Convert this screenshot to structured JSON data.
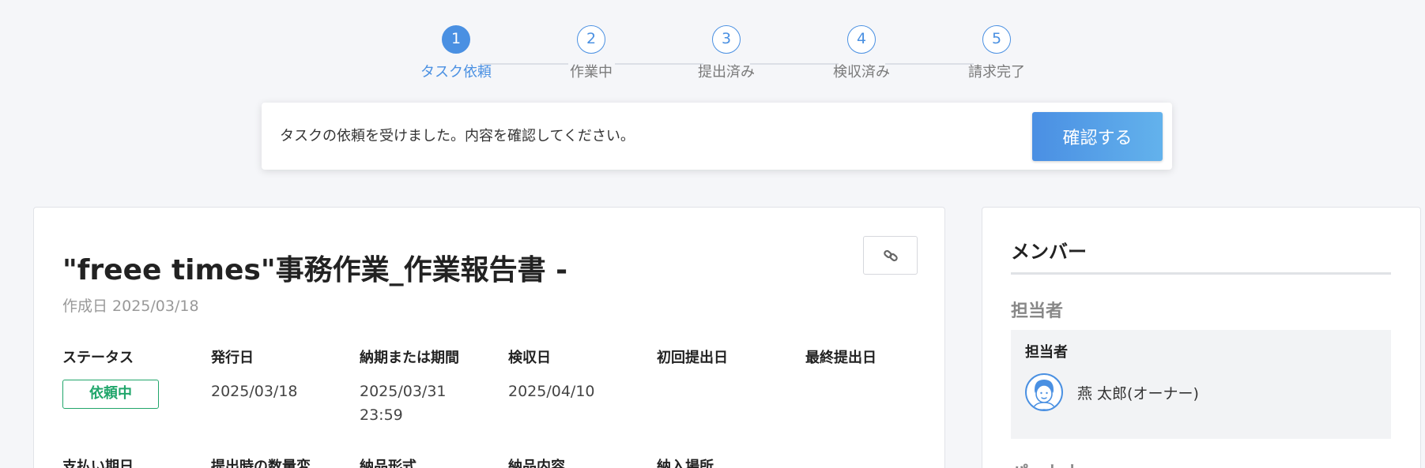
{
  "stepper": {
    "steps": [
      {
        "number": "1",
        "label": "タスク依頼",
        "active": true
      },
      {
        "number": "2",
        "label": "作業中",
        "active": false
      },
      {
        "number": "3",
        "label": "提出済み",
        "active": false
      },
      {
        "number": "4",
        "label": "検収済み",
        "active": false
      },
      {
        "number": "5",
        "label": "請求完了",
        "active": false
      }
    ]
  },
  "notice": {
    "message": "タスクの依頼を受けました。内容を確認してください。",
    "confirm_label": "確認する"
  },
  "task": {
    "title": "\"freee times\"事務作業_作業報告書 -",
    "created": "作成日 2025/03/18",
    "fields_row1": [
      {
        "label": "ステータス",
        "value": "依頼中",
        "type": "badge"
      },
      {
        "label": "発行日",
        "value": "2025/03/18"
      },
      {
        "label": "納期または期間",
        "value": "2025/03/31",
        "value2": "23:59"
      },
      {
        "label": "検収日",
        "value": "2025/04/10"
      },
      {
        "label": "初回提出日",
        "value": ""
      },
      {
        "label": "最終提出日",
        "value": ""
      }
    ],
    "fields_row2": [
      {
        "label": "支払い期日"
      },
      {
        "label": "提出時の数量変"
      },
      {
        "label": "納品形式"
      },
      {
        "label": "納品内容"
      },
      {
        "label": "納入場所"
      }
    ],
    "link_icon": "link-icon"
  },
  "members": {
    "title": "メンバー",
    "section_assignee": "担当者",
    "assignee_box_title": "担当者",
    "assignee_name": "燕 太郎(オーナー)",
    "section_partner": "パートナー",
    "colors": {
      "accent": "#4a90e2",
      "status": "#21a66b"
    }
  }
}
